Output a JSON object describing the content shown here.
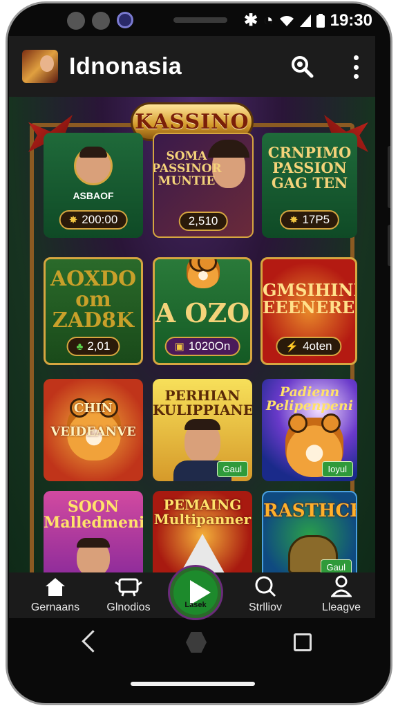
{
  "status_bar": {
    "time": "19:30",
    "icons": [
      "bluetooth-icon",
      "rotation-icon",
      "wifi-icon",
      "signal-icon",
      "battery-icon"
    ]
  },
  "app_bar": {
    "title": "Idnonasia",
    "search_icon": "search-icon",
    "menu_icon": "more-vert-icon"
  },
  "banner": {
    "title": "KASSINO"
  },
  "tiles": [
    {
      "title": "",
      "subtitle": "ASBAOF",
      "value": "200:00"
    },
    {
      "title": "SOMA\nPASSINOR\nMUNTIE",
      "value": "2,510"
    },
    {
      "title": "CRNPIMO\nPASSION\nGAG TEN",
      "value": "17P5"
    },
    {
      "title": "AOXDO\nom\nZAD8K",
      "value": "2,01"
    },
    {
      "title": "A OZO",
      "value": "1020On"
    },
    {
      "title": "GMSIHINIO\nEEENERES",
      "value": "4oten"
    },
    {
      "title": "CHIN\nVEIDEANVE",
      "value": ""
    },
    {
      "title": "PERHIAN\nKULIPPIANES",
      "tag": "Gaul"
    },
    {
      "title": "Padienn\nPelipenpeni",
      "tag": "Ioyul"
    },
    {
      "title": "SOON\nMalledmeni"
    },
    {
      "title": "PEMAING\nMultipanner"
    },
    {
      "title": "RASTHCK",
      "tag": "Gaul"
    }
  ],
  "bottom_nav": [
    {
      "label": "Gernaans",
      "icon": "home-icon"
    },
    {
      "label": "Glnodios",
      "icon": "chat-icon"
    },
    {
      "label": "Lasek",
      "icon": "play-icon"
    },
    {
      "label": "Strlliov",
      "icon": "search-icon"
    },
    {
      "label": "Lleagve",
      "icon": "profile-icon"
    }
  ],
  "colors": {
    "accent": "#1d8a2c",
    "gold": "#d6a640",
    "app_bar": "#1c1c1c"
  }
}
